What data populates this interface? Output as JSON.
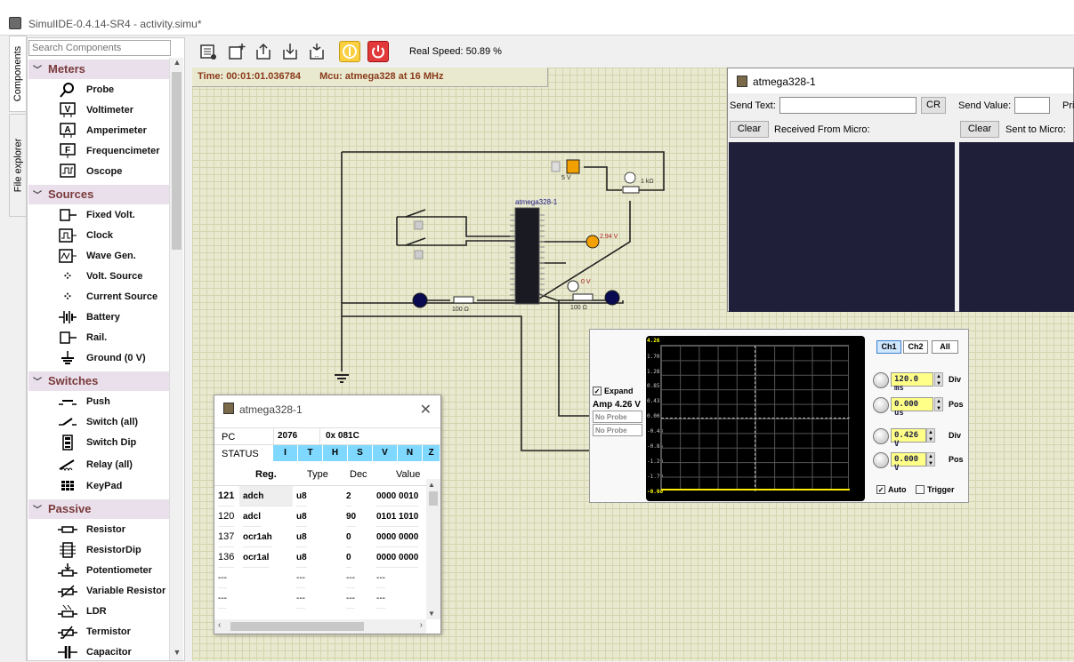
{
  "window": {
    "title": "SimulIDE-0.4.14-SR4  -  activity.simu*"
  },
  "side_tabs": {
    "components": "Components",
    "file_explorer": "File explorer"
  },
  "search": {
    "placeholder": "Search Components"
  },
  "categories": [
    {
      "name": "Meters",
      "items": [
        "Probe",
        "Voltimeter",
        "Amperimeter",
        "Frequencimeter",
        "Oscope"
      ]
    },
    {
      "name": "Sources",
      "items": [
        "Fixed Volt.",
        "Clock",
        "Wave Gen.",
        "Volt. Source",
        "Current Source",
        "Battery",
        "Rail.",
        "Ground (0 V)"
      ]
    },
    {
      "name": "Switches",
      "items": [
        "Push",
        "Switch (all)",
        "Switch Dip",
        "Relay (all)",
        "KeyPad"
      ]
    },
    {
      "name": "Passive",
      "items": [
        "Resistor",
        "ResistorDip",
        "Potentiometer",
        "Variable Resistor",
        "LDR",
        "Termistor",
        "Capacitor"
      ]
    }
  ],
  "toolbar": {
    "speed": "Real Speed: 50.89 %"
  },
  "infobar": {
    "time": "Time: 00:01:01.036784",
    "mcu": "Mcu: atmega328 at 16 MHz"
  },
  "circuit": {
    "chip_label": "atmega328-1",
    "v5": "5 V",
    "pot": "1 kΩ",
    "probe1": "2.94 V",
    "probe2": "0 V",
    "r1": "100 Ω",
    "r2": "100 Ω"
  },
  "serial": {
    "title": "atmega328-1",
    "send_text_label": "Send Text:",
    "cr": "CR",
    "send_value_label": "Send Value:",
    "print_label": "Pri",
    "clear1": "Clear",
    "received": "Received From Micro:",
    "clear2": "Clear",
    "sent": "Sent to Micro:"
  },
  "oscope": {
    "y_labels": [
      "4.26",
      "1.70",
      "1.28",
      "0.85",
      "0.43",
      "0.00",
      "-0.43",
      "-0.85",
      "-1.28",
      "-1.70",
      "-0.00"
    ],
    "expand": "Expand",
    "amp": "Amp 4.26 V",
    "probe1": "No Probe",
    "probe2": "No Probe",
    "ch1": "Ch1",
    "ch2": "Ch2",
    "all": "All",
    "time_div": "120.0 ms",
    "time_div_label": "Div",
    "time_pos": "0.000 us",
    "time_pos_label": "Pos",
    "volt_div": "0.426 V",
    "volt_div_label": "Div",
    "volt_pos": "0.000 V",
    "volt_pos_label": "Pos",
    "auto": "Auto",
    "trigger": "Trigger"
  },
  "registers": {
    "title": "atmega328-1",
    "pc_label": "PC",
    "pc_dec": "2076",
    "pc_hex": "0x 081C",
    "status_label": "STATUS",
    "flags": [
      "I",
      "T",
      "H",
      "S",
      "V",
      "N",
      "Z"
    ],
    "headers": [
      "Reg.",
      "Type",
      "Dec",
      "Value"
    ],
    "rows": [
      {
        "addr": "121",
        "reg": "adch",
        "type": "u8",
        "dec": "2",
        "value": "0000 0010"
      },
      {
        "addr": "120",
        "reg": "adcl",
        "type": "u8",
        "dec": "90",
        "value": "0101 1010"
      },
      {
        "addr": "137",
        "reg": "ocr1ah",
        "type": "u8",
        "dec": "0",
        "value": "0000 0000"
      },
      {
        "addr": "136",
        "reg": "ocr1al",
        "type": "u8",
        "dec": "0",
        "value": "0000 0000"
      },
      {
        "addr": "---",
        "reg": "",
        "type": "---",
        "dec": "---",
        "value": "---"
      },
      {
        "addr": "---",
        "reg": "",
        "type": "---",
        "dec": "---",
        "value": "---"
      }
    ]
  }
}
